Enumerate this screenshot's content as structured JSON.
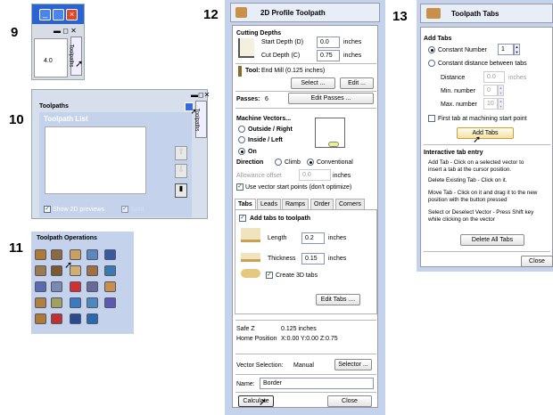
{
  "step_numbers": {
    "n9": "9",
    "n10": "10",
    "n11": "11",
    "n12": "12",
    "n13": "13"
  },
  "fig9": {
    "tab_label": "Toolpaths",
    "ruler_value": "4.0"
  },
  "fig10": {
    "panel_title": "Toolpaths",
    "side_tab": "Toolpaths",
    "list_title": "Toolpath List",
    "show_2d_label": "Show 2D previews",
    "solid_label": "Solid"
  },
  "fig11": {
    "title": "Toolpath Operations"
  },
  "profile": {
    "title": "2D Profile Toolpath",
    "cutting_depths": "Cutting Depths",
    "start_depth_label": "Start Depth (D)",
    "start_depth": "0.0",
    "cut_depth_label": "Cut Depth (C)",
    "cut_depth": "0.75",
    "units": "inches",
    "tool_label": "Tool:",
    "tool_value": "End Mill (0.125 inches)",
    "select_btn": "Select ...",
    "edit_btn": "Edit ...",
    "passes_label": "Passes:",
    "passes_value": "6",
    "edit_passes_btn": "Edit Passes ...",
    "machine_vectors": "Machine Vectors...",
    "outside": "Outside / Right",
    "inside": "Inside / Left",
    "on": "On",
    "direction_label": "Direction",
    "climb": "Climb",
    "conventional": "Conventional",
    "allowance_label": "Allowance offset",
    "allowance_value": "0.0",
    "use_vector_start": "Use vector start points (don't optimize)",
    "tabs": [
      "Tabs",
      "Leads",
      "Ramps",
      "Order",
      "Corners"
    ],
    "add_tabs": "Add tabs to toolpath",
    "length_label": "Length",
    "length_value": "0.2",
    "thickness_label": "Thickness",
    "thickness_value": "0.15",
    "create_3d": "Create 3D tabs",
    "edit_tabs_btn": "Edit Tabs ....",
    "safe_z_label": "Safe Z",
    "safe_z_value": "0.125 inches",
    "home_label": "Home Position",
    "home_value": "X:0.00 Y:0.00 Z:0.75",
    "vector_sel_label": "Vector Selection:",
    "vector_sel_value": "Manual",
    "selector_btn": "Selector ...",
    "name_label": "Name:",
    "name_value": "Border",
    "calculate_btn": "Calculate",
    "close_btn": "Close"
  },
  "tabs_panel": {
    "title": "Toolpath Tabs",
    "add_tabs": "Add Tabs",
    "constant_number": "Constant Number",
    "constant_number_value": "1",
    "constant_distance": "Constant distance between tabs",
    "distance_label": "Distance",
    "distance_value": "0.0",
    "distance_units": "inches",
    "min_label": "Min. number",
    "min_value": "0",
    "max_label": "Max. number",
    "max_value": "10",
    "first_tab": "First tab at machining start point",
    "add_tabs_btn": "Add Tabs",
    "interactive_title": "Interactive tab entry",
    "add_tab_help": "Add Tab - Click on a selected vector to insert a tab at the cursor position.",
    "delete_help": "Delete Existing Tab - Click on it.",
    "move_help": "Move Tab - Click on it and drag it to the new position with the button pressed",
    "select_help": "Select or Deselect Vector - Press Shift key while clicking on the vector",
    "delete_all_btn": "Delete All Tabs",
    "close_btn": "Close"
  },
  "colors": {
    "panel": "#c4d2ec",
    "title_bar": "#e8eef8",
    "accent": "#2050b8"
  }
}
